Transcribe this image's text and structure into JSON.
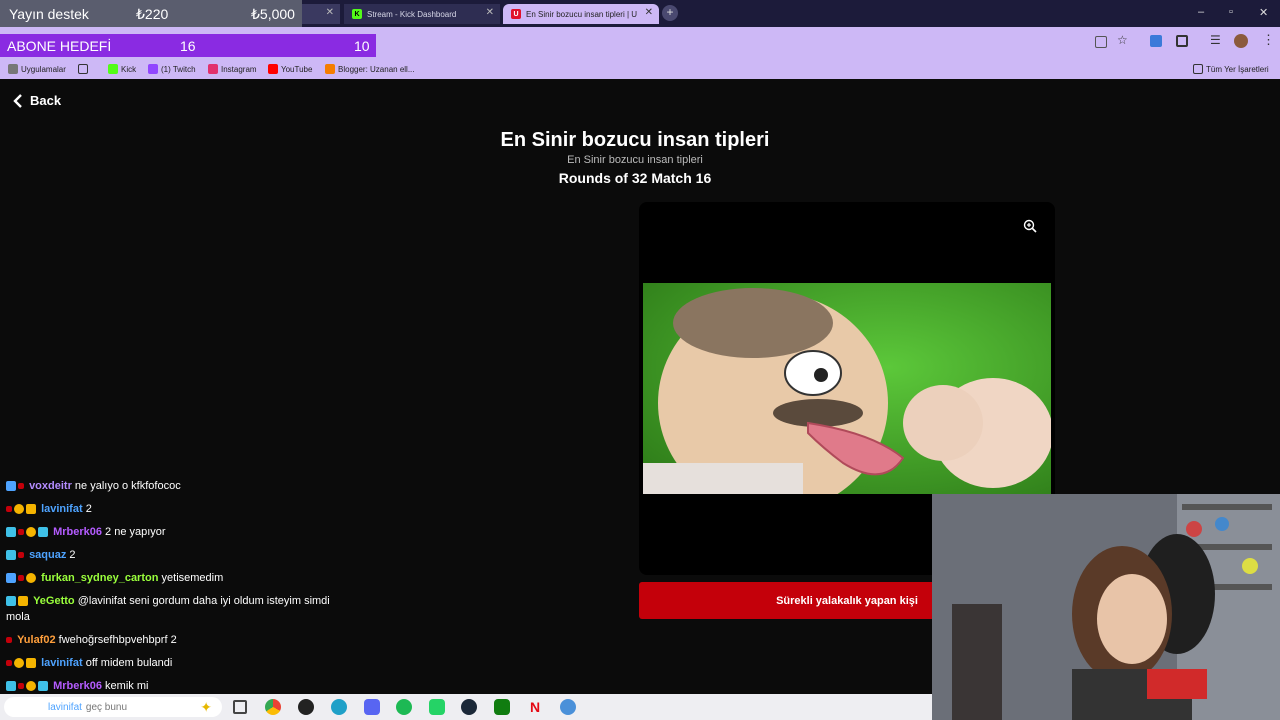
{
  "browser": {
    "tabs": [
      {
        "label": "",
        "favicon": "blank"
      },
      {
        "label": "Stream - Kick Dashboard",
        "favicon": "K"
      },
      {
        "label": "En Sinir bozucu insan tipleri | U",
        "favicon": "U"
      }
    ],
    "bookmarks": [
      {
        "label": "Uygulamalar"
      },
      {
        "label": ""
      },
      {
        "label": "Kick"
      },
      {
        "label": "(1) Twitch"
      },
      {
        "label": "Instagram"
      },
      {
        "label": "YouTube"
      },
      {
        "label": "Blogger: Uzanan ell..."
      }
    ],
    "all_bookmarks": "Tüm Yer İşaretleri"
  },
  "overlay": {
    "donation_label": "Yayın destek",
    "donation_current": "₺220",
    "donation_target": "₺5,000",
    "subgoal_label": "ABONE HEDEFİ",
    "subgoal_current": "16",
    "subgoal_target": "10"
  },
  "page": {
    "back_label": "Back",
    "title": "En Sinir bozucu insan tipleri",
    "subtitle": "En Sinir bozucu insan tipleri",
    "rounds": "Rounds of 32 Match 16",
    "choice_label": "Sürekli yalakalık yapan kişi"
  },
  "chat": [
    {
      "user": "voxdeitr",
      "text": "ne yalıyo o kfkfofococ",
      "color": "#b48cff"
    },
    {
      "user": "lavinifat",
      "text": "2",
      "color": "#4ea3ff"
    },
    {
      "user": "Mrberk06",
      "text": "2 ne yapıyor",
      "color": "#b45cff"
    },
    {
      "user": "saquaz",
      "text": "2",
      "color": "#4ea3ff"
    },
    {
      "user": "furkan_sydney_carton",
      "text": "yetisemedim",
      "color": "#9aff3c"
    },
    {
      "user": "YeGetto",
      "text": "@lavinifat seni gordum daha iyi oldum isteyim simdi mola",
      "color": "#ffffff"
    },
    {
      "user": "Yulaf02",
      "text": "fwehoğrsefhbpvehbprf 2",
      "color": "#ff9f3c"
    },
    {
      "user": "lavinifat",
      "text": "off midem bulandi",
      "color": "#4ea3ff"
    },
    {
      "user": "Mrberk06",
      "text": "kemik mi",
      "color": "#b45cff"
    }
  ],
  "taskbar": {
    "search_user": "lavinifat",
    "search_text": "geç bunu"
  },
  "colors": {
    "accent": "#c4000a",
    "subgoal_bg": "#8a2be2",
    "chrome_bg": "#cdb8f6"
  }
}
